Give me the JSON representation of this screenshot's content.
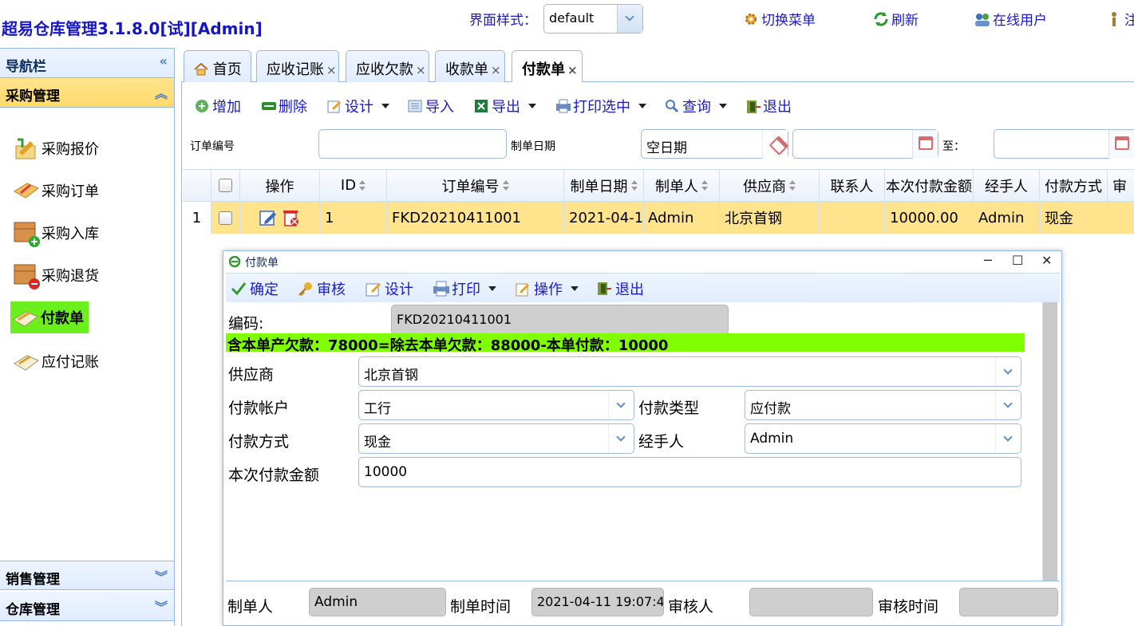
{
  "app": {
    "title": "超易仓库管理3.1.8.0[试][Admin]",
    "theme_label": "界面样式：",
    "theme_value": "default",
    "header_buttons": [
      "切换菜单",
      "刷新",
      "在线用户",
      "注"
    ]
  },
  "nav": {
    "title": "导航栏",
    "purchase_section": "采购管理",
    "items": [
      {
        "label": "采购报价",
        "icon": "quote-icon"
      },
      {
        "label": "采购订单",
        "icon": "order-icon"
      },
      {
        "label": "采购入库",
        "icon": "box-add-icon"
      },
      {
        "label": "采购退货",
        "icon": "box-remove-icon"
      },
      {
        "label": "付款单",
        "icon": "payment-icon",
        "active": true
      },
      {
        "label": "应付记账",
        "icon": "ledger-icon"
      }
    ],
    "sales_section": "销售管理",
    "warehouse_section": "仓库管理"
  },
  "tabs": [
    {
      "label": "首页"
    },
    {
      "label": "应收记账"
    },
    {
      "label": "应收欠款"
    },
    {
      "label": "收款单"
    },
    {
      "label": "付款单",
      "active": true
    }
  ],
  "toolbar": {
    "add": "增加",
    "delete": "删除",
    "design": "设计",
    "import": "导入",
    "export": "导出",
    "print_selected": "打印选中",
    "query": "查询",
    "exit": "退出"
  },
  "filter": {
    "order_no_label": "订单编号",
    "order_no_value": "",
    "date_label": "制单日期",
    "date_mode": "空日期",
    "date_from": "",
    "to_label": "至：",
    "date_to": ""
  },
  "grid": {
    "columns": [
      "操作",
      "ID",
      "订单编号",
      "制单日期",
      "制单人",
      "供应商",
      "联系人",
      "本次付款金额",
      "经手人",
      "付款方式",
      "审"
    ],
    "rows": [
      {
        "rownum": "1",
        "id": "1",
        "order_no": "FKD20210411001",
        "date": "2021-04-1",
        "maker": "Admin",
        "supplier": "北京首钢",
        "contact": "",
        "amount": "10000.00",
        "handler": "Admin",
        "pay_method": "现金",
        "audit": ""
      }
    ]
  },
  "dialog": {
    "title": "付款单",
    "toolbar": {
      "confirm": "确定",
      "audit": "审核",
      "design": "设计",
      "print": "打印",
      "operate": "操作",
      "exit": "退出"
    },
    "code_label": "编码:",
    "code_value": "FKD20210411001",
    "debt_text": "含本单产欠款：78000=除去本单欠款：88000-本单付款：10000",
    "supplier_label": "供应商",
    "supplier_value": "北京首钢",
    "account_label": "付款帐户",
    "account_value": "工行",
    "pay_type_label": "付款类型",
    "pay_type_value": "应付款",
    "pay_method_label": "付款方式",
    "pay_method_value": "现金",
    "handler_label": "经手人",
    "handler_value": "Admin",
    "amount_label": "本次付款金额",
    "amount_value": "10000",
    "footer": {
      "maker_label": "制单人",
      "maker_value": "Admin",
      "make_time_label": "制单时间",
      "make_time_value": "2021-04-11 19:07:42",
      "auditor_label": "审核人",
      "auditor_value": "",
      "audit_time_label": "审核时间",
      "audit_time_value": ""
    }
  },
  "colors": {
    "title_blue": "#1515c8",
    "link_blue": "#1a1acc",
    "selected_row": "#ffe48d",
    "active_nav": "#6bf01e",
    "debt_bar": "#80ff00",
    "border": "#95b8e7"
  }
}
